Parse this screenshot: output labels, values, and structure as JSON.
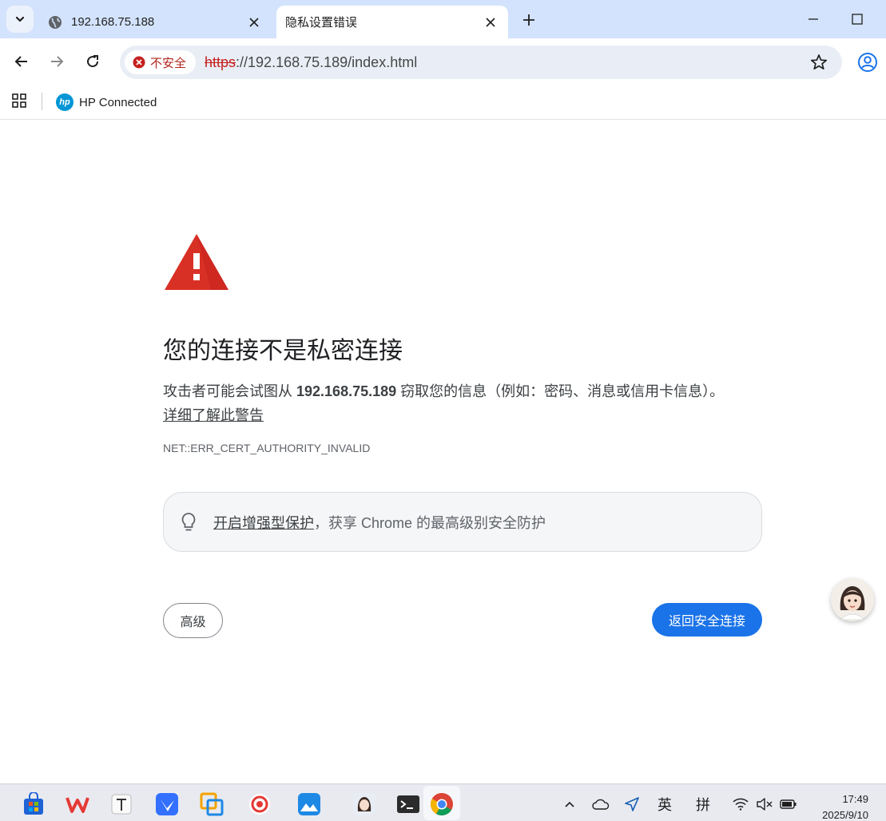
{
  "browser": {
    "tabs": [
      {
        "title": "192.168.75.188",
        "icon": "globe-icon",
        "active": false
      },
      {
        "title": "隐私设置错误",
        "icon": "none",
        "active": true
      }
    ],
    "security_chip": "不安全",
    "url_scheme": "https",
    "url_rest": "://192.168.75.189/index.html",
    "bookmarks": [
      {
        "label": "HP Connected",
        "logo_text": "hp"
      }
    ]
  },
  "interstitial": {
    "headline": "您的连接不是私密连接",
    "explain_before": "攻击者可能会试图从 ",
    "explain_host": "192.168.75.189",
    "explain_after": " 窃取您的信息（例如：密码、消息或信用卡信息）。",
    "learn_more": "详细了解此警告",
    "error_code": "NET::ERR_CERT_AUTHORITY_INVALID",
    "enhanced_link": "开启增强型保护",
    "enhanced_rest": "，获享 Chrome 的最高级别安全防护",
    "advanced_button": "高级",
    "back_button": "返回安全连接"
  },
  "taskbar": {
    "tray_lang": "英",
    "tray_ime": "拼",
    "time": "17:49",
    "date": "2025/9/10"
  },
  "colors": {
    "tab_strip": "#d3e3fd",
    "warning_red": "#d93025",
    "primary_blue": "#1a73e8",
    "insecure_red": "#c5221f"
  }
}
